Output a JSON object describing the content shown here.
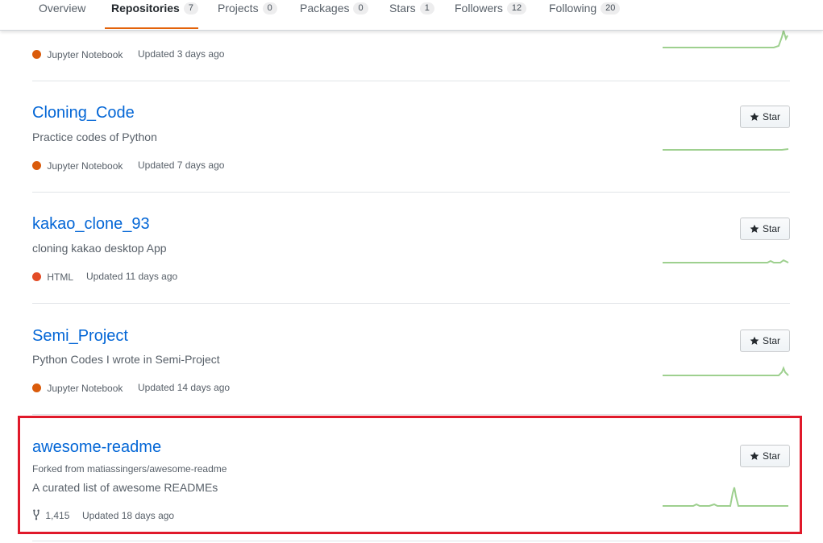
{
  "nav": {
    "tabs": [
      {
        "label": "Overview",
        "count": null
      },
      {
        "label": "Repositories",
        "count": "7"
      },
      {
        "label": "Projects",
        "count": "0"
      },
      {
        "label": "Packages",
        "count": "0"
      },
      {
        "label": "Stars",
        "count": "1"
      },
      {
        "label": "Followers",
        "count": "12"
      },
      {
        "label": "Following",
        "count": "20"
      }
    ]
  },
  "repos": [
    {
      "name": "",
      "language": "Jupyter Notebook",
      "lang_color": "#DA5B0B",
      "updated": "Updated 3 days ago"
    },
    {
      "name": "Cloning_Code",
      "description": "Practice codes of Python",
      "language": "Jupyter Notebook",
      "lang_color": "#DA5B0B",
      "updated": "Updated 7 days ago",
      "star_label": "Star"
    },
    {
      "name": "kakao_clone_93",
      "description": "cloning kakao desktop App",
      "language": "HTML",
      "lang_color": "#e34c26",
      "updated": "Updated 11 days ago",
      "star_label": "Star"
    },
    {
      "name": "Semi_Project",
      "description": "Python Codes I wrote in Semi-Project",
      "language": "Jupyter Notebook",
      "lang_color": "#DA5B0B",
      "updated": "Updated 14 days ago",
      "star_label": "Star"
    },
    {
      "name": "awesome-readme",
      "forked_from": "Forked from matiassingers/awesome-readme",
      "description": "A curated list of awesome READMEs",
      "forks": "1,415",
      "updated": "Updated 18 days ago",
      "star_label": "Star"
    }
  ],
  "colors": {
    "link": "#0366d6",
    "active_tab": "#e36209",
    "highlight": "#e0192a",
    "sparkline": "#9ed08f"
  }
}
